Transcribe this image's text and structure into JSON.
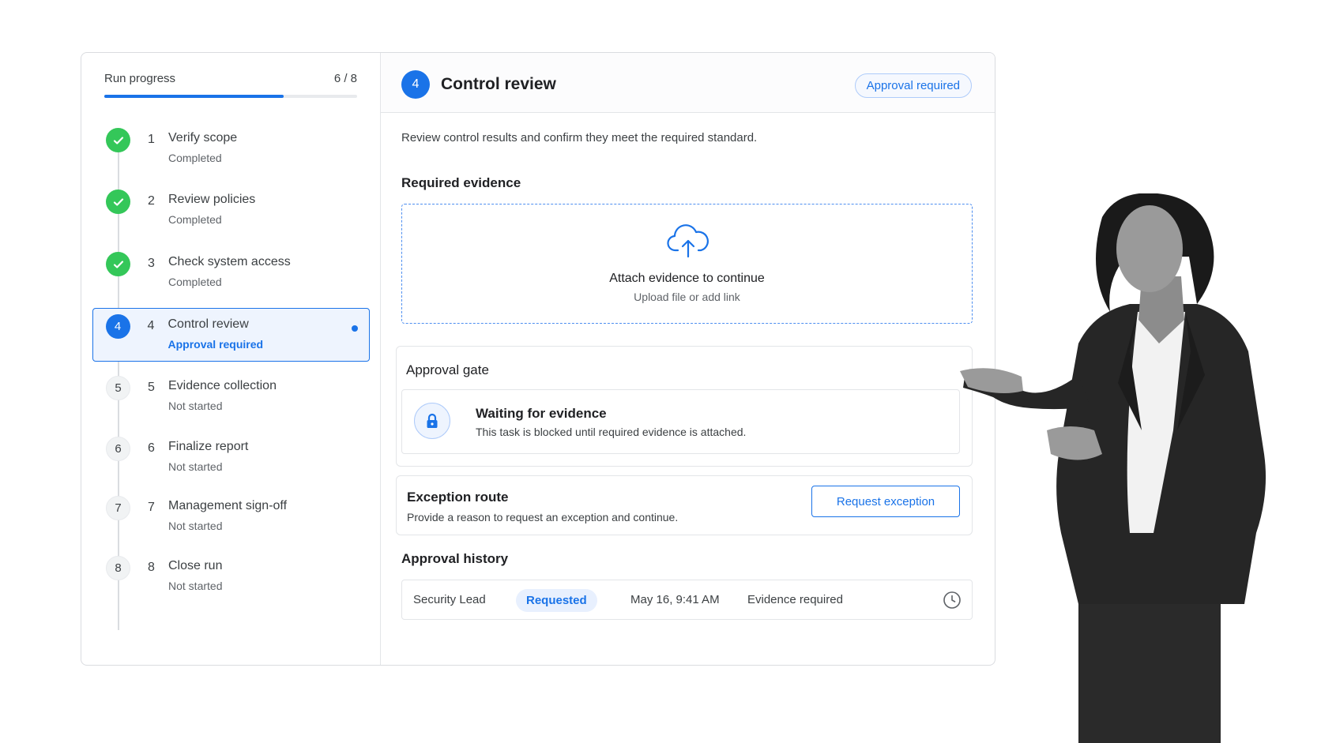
{
  "progress": {
    "label": "Run progress",
    "count_text": "6 / 8",
    "fraction": 0.71
  },
  "steps": [
    {
      "number": "1",
      "title": "Verify scope",
      "status": "Completed",
      "state": "done"
    },
    {
      "number": "2",
      "title": "Review policies",
      "status": "Completed",
      "state": "done"
    },
    {
      "number": "3",
      "title": "Check system access",
      "status": "Completed",
      "state": "done"
    },
    {
      "number": "4",
      "title": "Control review",
      "status": "Approval required",
      "state": "current",
      "circle": "4"
    },
    {
      "number": "5",
      "title": "Evidence collection",
      "status": "Not started",
      "state": "todo",
      "circle": "5"
    },
    {
      "number": "6",
      "title": "Finalize report",
      "status": "Not started",
      "state": "todo",
      "circle": "6"
    },
    {
      "number": "7",
      "title": "Management sign-off",
      "status": "Not started",
      "state": "todo",
      "circle": "7"
    },
    {
      "number": "8",
      "title": "Close run",
      "status": "Not started",
      "state": "todo",
      "circle": "8"
    }
  ],
  "header": {
    "badge": "4",
    "title": "Control review",
    "pill": "Approval required"
  },
  "description": "Review control results and confirm they meet the required standard.",
  "evidence": {
    "section_title": "Required evidence",
    "drop_title": "Attach evidence to continue",
    "drop_sub": "Upload file or add link",
    "icon": "cloud-upload-icon"
  },
  "gate": {
    "title": "Approval gate",
    "inner_title": "Waiting for evidence",
    "inner_sub": "This task is blocked until required evidence is attached.",
    "icon": "lock-icon"
  },
  "exception": {
    "title": "Exception route",
    "sub": "Provide a reason to request an exception and continue.",
    "button": "Request exception"
  },
  "history": {
    "section_title": "Approval history",
    "rows": [
      {
        "role": "Security Lead",
        "status": "Requested",
        "date": "May 16, 9:41 AM",
        "note": "Evidence required"
      }
    ]
  },
  "colors": {
    "accent": "#1a73e8",
    "success": "#34c759",
    "border": "#e3e5e8"
  }
}
